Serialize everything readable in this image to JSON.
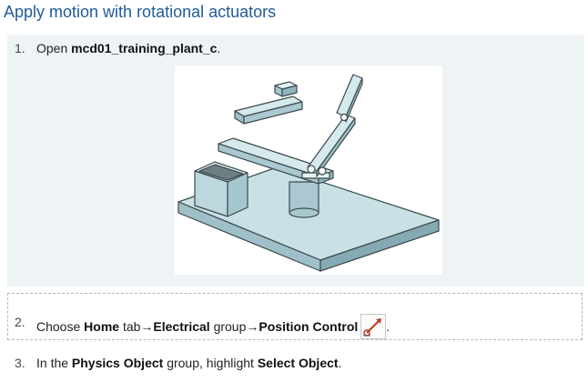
{
  "title": "Apply motion with rotational actuators",
  "steps": [
    {
      "num": "1.",
      "text_before": "Open ",
      "bold1": "mcd01_training_plant_c",
      "text_after": "."
    },
    {
      "num": "2.",
      "text_before": "Choose ",
      "bold1": "Home",
      "t1": " tab",
      "arrow1": "→",
      "bold2": "Electrical",
      "t2": " group",
      "arrow2": "→",
      "bold3": "Position Control",
      "icon": "position-control-icon",
      "text_after": "."
    },
    {
      "num": "3.",
      "text_before": "In the ",
      "bold1": "Physics Object",
      "t1": " group, highlight ",
      "bold2": "Select Object",
      "text_after": "."
    }
  ],
  "colors": {
    "title": "#1f5c99",
    "model_face": "#c9e0e5",
    "model_side": "#8fb5be",
    "model_edge": "#3c4a4e",
    "icon_accent": "#c0392b"
  }
}
